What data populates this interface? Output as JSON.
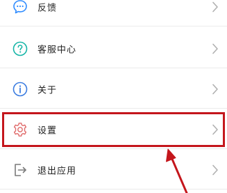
{
  "menu": {
    "items": [
      {
        "label": "反馈",
        "icon": "feedback-icon"
      },
      {
        "label": "客服中心",
        "icon": "help-icon"
      },
      {
        "label": "关于",
        "icon": "info-icon"
      },
      {
        "label": "设置",
        "icon": "settings-gear-icon"
      },
      {
        "label": "退出应用",
        "icon": "logout-icon"
      }
    ]
  },
  "colors": {
    "feedback_icon": "#2f8cff",
    "help_icon": "#16b5a7",
    "info_icon": "#3a7be0",
    "settings_icon": "#e06a6a",
    "logout_icon": "#7a7a7a",
    "highlight_box": "#c4161c",
    "annotation_arrow": "#c4161c",
    "chevron": "#b0b0b0",
    "divider": "#ebebeb"
  }
}
